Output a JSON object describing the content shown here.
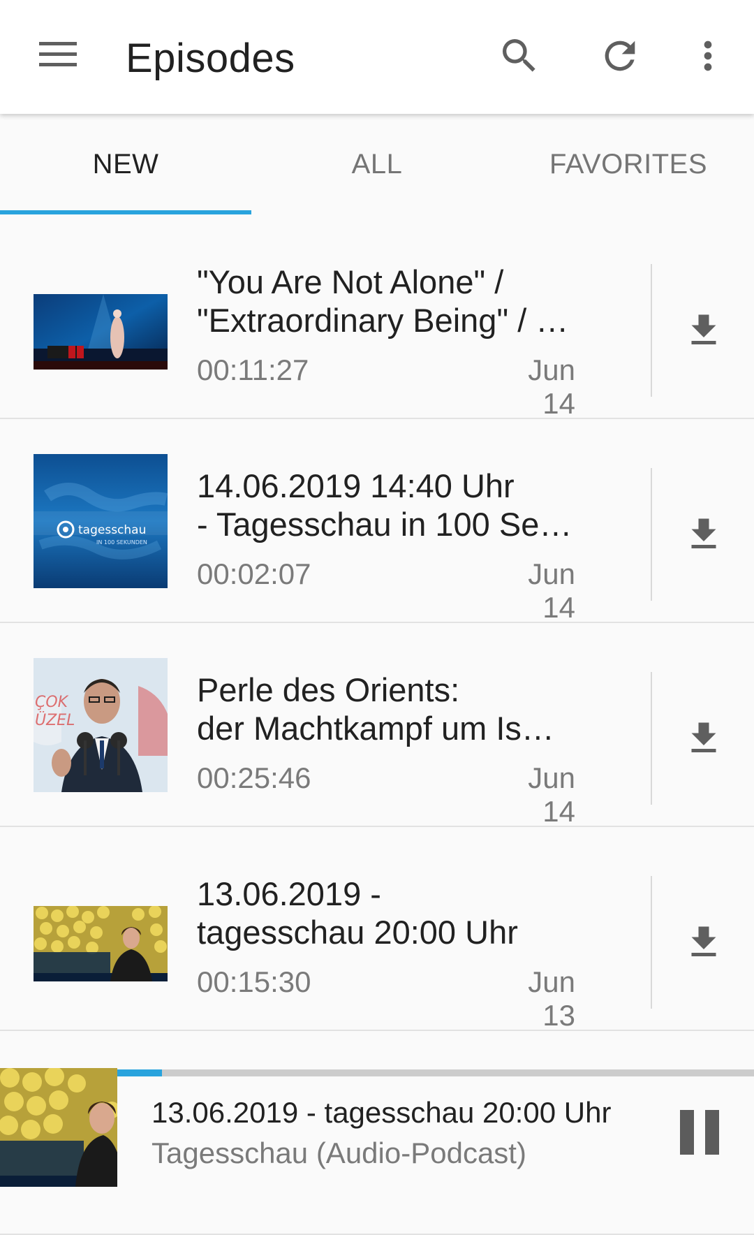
{
  "appbar": {
    "title": "Episodes",
    "icons": [
      "menu-icon",
      "search-icon",
      "refresh-icon",
      "more-vert-icon"
    ]
  },
  "tabs": [
    {
      "label": "NEW",
      "active": true
    },
    {
      "label": "ALL",
      "active": false
    },
    {
      "label": "FAVORITES",
      "active": false
    }
  ],
  "episodes": [
    {
      "title_line1": "\"You Are Not Alone\" /",
      "title_line2": "\"Extraordinary Being\" / …",
      "duration": "00:11:27",
      "date": "Jun 14"
    },
    {
      "title_line1": "14.06.2019 14:40 Uhr",
      "title_line2": "- Tagesschau in 100 Se…",
      "duration": "00:02:07",
      "date": "Jun 14",
      "thumb_brand": "tagesschau",
      "thumb_sub": "IN 100 SEKUNDEN"
    },
    {
      "title_line1": "Perle des Orients:",
      "title_line2": "der Machtkampf um Is…",
      "duration": "00:25:46",
      "date": "Jun 14"
    },
    {
      "title_line1": "13.06.2019 -",
      "title_line2": "tagesschau 20:00 Uhr",
      "duration": "00:15:30",
      "date": "Jun 13"
    }
  ],
  "player": {
    "title": "13.06.2019 - tagesschau 20:00 Uhr",
    "subtitle": "Tagesschau (Audio-Podcast)",
    "progress": 0.07
  },
  "colors": {
    "accent": "#29a3dd",
    "icon": "#5f5f5f",
    "secondary_text": "#7a7a7a"
  }
}
